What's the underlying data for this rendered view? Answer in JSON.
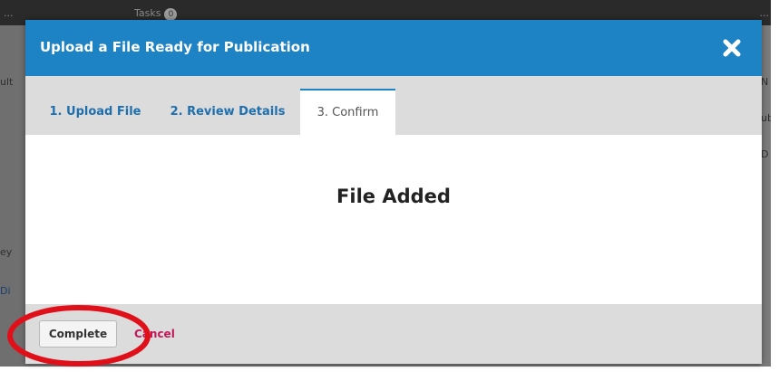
{
  "background": {
    "user_label": "...",
    "tasks_label": "Tasks",
    "tasks_count": "0",
    "right_label": "...",
    "snippets": [
      "ult",
      "ey",
      "Di",
      "N",
      "ub",
      "D"
    ]
  },
  "modal": {
    "title": "Upload a File Ready for Publication",
    "close_icon": "close-icon",
    "tabs": [
      {
        "label": "1. Upload File"
      },
      {
        "label": "2. Review Details"
      },
      {
        "label": "3. Confirm"
      }
    ],
    "body": {
      "heading": "File Added"
    },
    "footer": {
      "complete_label": "Complete",
      "cancel_label": "Cancel"
    }
  },
  "colors": {
    "header_blue": "#1e83c4",
    "tab_link": "#1e6fae",
    "cancel_link": "#c2185b",
    "annotation_red": "#e0101a"
  }
}
